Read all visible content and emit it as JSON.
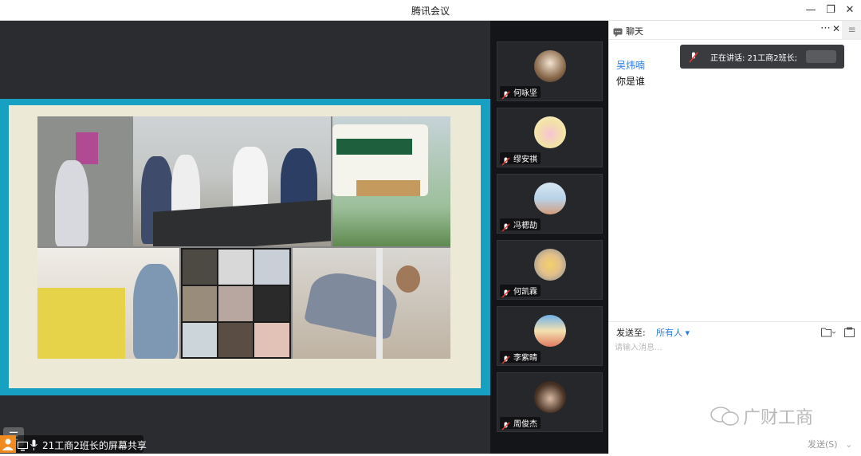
{
  "window": {
    "title": "腾讯会议"
  },
  "share": {
    "status_label": "21工商2班长的屏幕共享"
  },
  "participants": [
    {
      "name": "何咏坚",
      "avatar_color": "#8a6a4c"
    },
    {
      "name": "缪安祺",
      "avatar_color": "#f3e2a6"
    },
    {
      "name": "冯楒劼",
      "avatar_color": "#b9d3e8"
    },
    {
      "name": "何凯霖",
      "avatar_color": "#e4c08a"
    },
    {
      "name": "李紫晴",
      "avatar_color": "#6fb0e6"
    },
    {
      "name": "周俊杰",
      "avatar_color": "#4a3426"
    }
  ],
  "chat": {
    "title": "聊天",
    "message": {
      "sender": "吴炜喃",
      "text": "你是谁"
    },
    "speaking_banner": "正在讲话: 21工商2班长;",
    "send_to_label": "发送至:",
    "send_to_value": "所有人",
    "input_placeholder": "请输入消息...",
    "send_button": "发送(S)",
    "watermark": "广财工商"
  },
  "colors": {
    "share_border": "#17a0c1",
    "accent": "#2a7de1",
    "stage_bg": "#2b2c2f"
  }
}
